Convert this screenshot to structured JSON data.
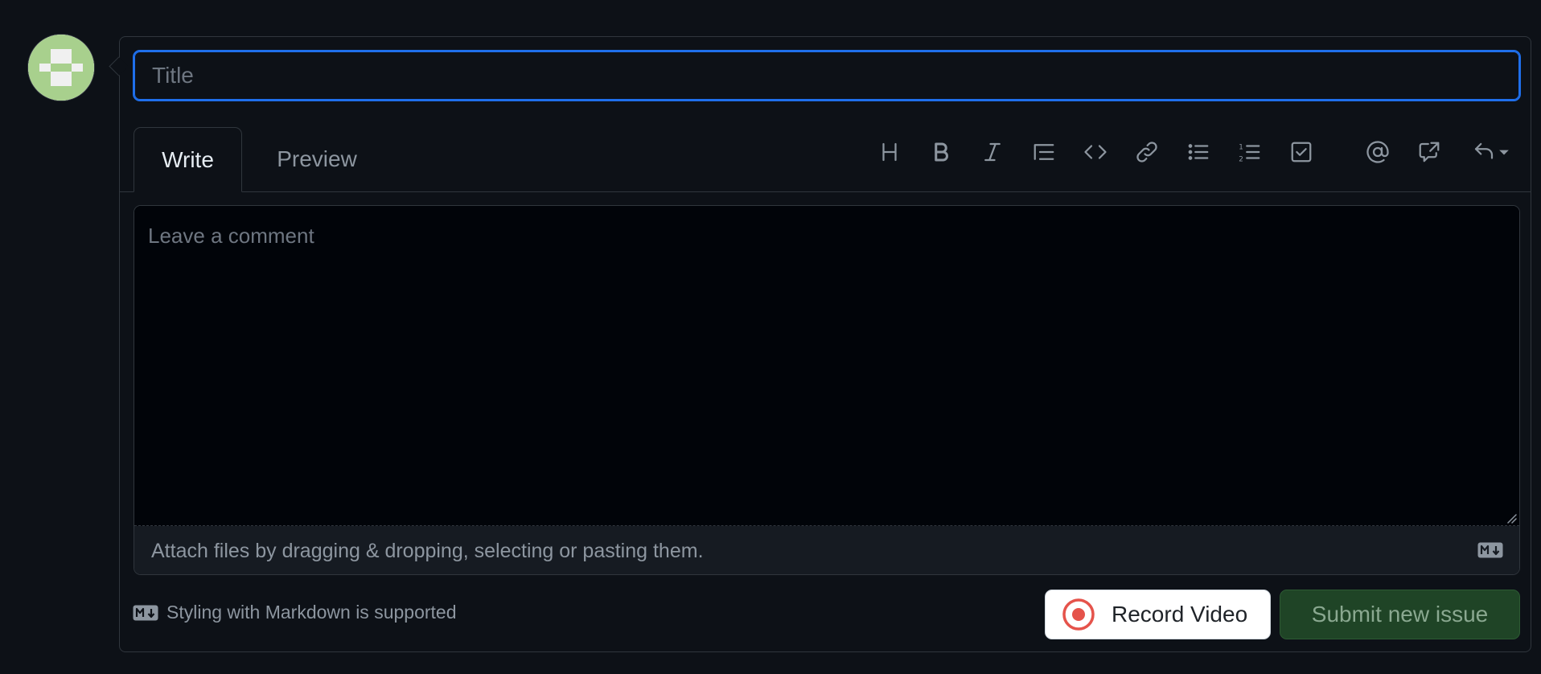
{
  "avatar": {
    "icon": "identicon-avatar",
    "colors": {
      "fill": "#a8d08d",
      "background": "#f0f0f0"
    }
  },
  "title": {
    "placeholder": "Title",
    "value": ""
  },
  "tabs": [
    {
      "label": "Write",
      "active": true
    },
    {
      "label": "Preview",
      "active": false
    }
  ],
  "toolbar": [
    {
      "icon": "heading-icon"
    },
    {
      "icon": "bold-icon"
    },
    {
      "icon": "italic-icon"
    },
    {
      "icon": "quote-icon"
    },
    {
      "icon": "code-icon"
    },
    {
      "icon": "link-icon"
    },
    {
      "icon": "unordered-list-icon"
    },
    {
      "icon": "ordered-list-icon"
    },
    {
      "icon": "task-list-icon"
    },
    {
      "icon": "mention-icon"
    },
    {
      "icon": "cross-reference-icon"
    },
    {
      "icon": "reply-icon"
    }
  ],
  "comment": {
    "placeholder": "Leave a comment",
    "value": "",
    "attach_text": "Attach files by dragging & dropping, selecting or pasting them."
  },
  "footer": {
    "markdown_note": "Styling with Markdown is supported",
    "record_label": "Record Video",
    "submit_label": "Submit new issue"
  },
  "colors": {
    "background": "#0d1117",
    "focus_border": "#1f6feb",
    "submit_bg": "#1f4426",
    "record_icon": "#e5534b"
  }
}
